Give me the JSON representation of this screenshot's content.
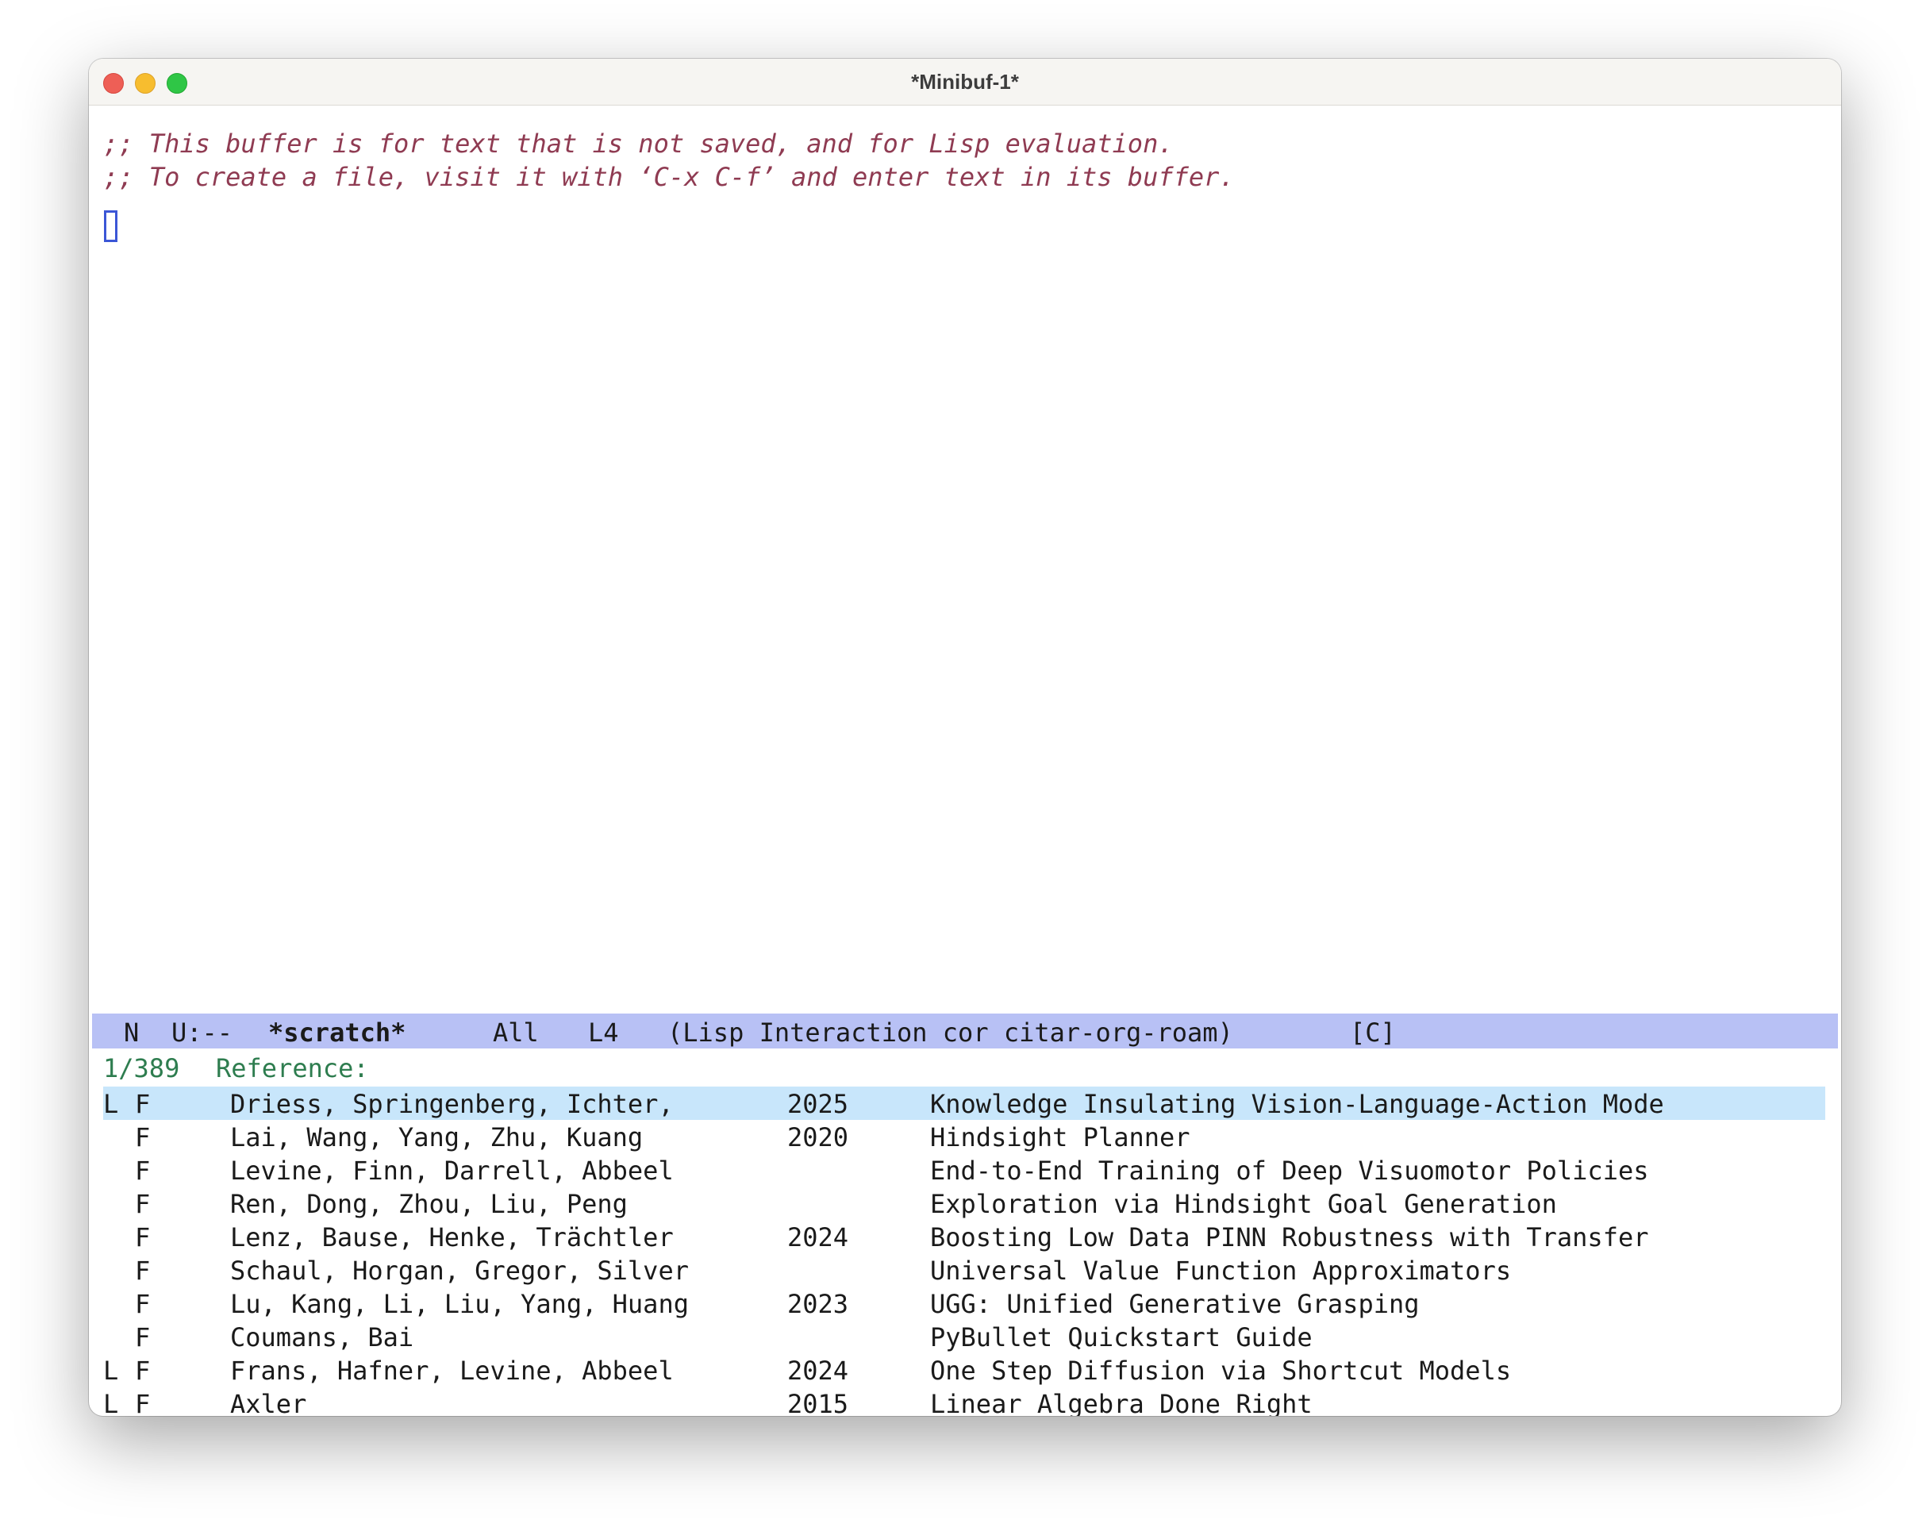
{
  "window": {
    "title": "*Minibuf-1*"
  },
  "editor": {
    "comment_line_1": ";; This buffer is for text that is not saved, and for Lisp evaluation.",
    "comment_line_2": ";; To create a file, visit it with ‘C-x C-f’ and enter text in its buffer."
  },
  "modeline": {
    "state": "N",
    "status": "U:--",
    "buffer_name": "*scratch*",
    "position": "All",
    "line": "L4",
    "modes": "(Lisp Interaction cor citar-org-roam)",
    "indicator": "[C]"
  },
  "minibuffer": {
    "count": "1/389",
    "prompt": "Reference:",
    "candidates": [
      {
        "flag_l": "L",
        "flag_f": "F",
        "authors": "Driess, Springenberg, Ichter,",
        "year": "2025",
        "title": "Knowledge Insulating Vision-Language-Action Mode",
        "selected": true
      },
      {
        "flag_l": "",
        "flag_f": "F",
        "authors": "Lai, Wang, Yang, Zhu, Kuang",
        "year": "2020",
        "title": "Hindsight Planner",
        "selected": false
      },
      {
        "flag_l": "",
        "flag_f": "F",
        "authors": "Levine, Finn, Darrell, Abbeel",
        "year": "",
        "title": "End-to-End Training of Deep Visuomotor Policies",
        "selected": false
      },
      {
        "flag_l": "",
        "flag_f": "F",
        "authors": "Ren, Dong, Zhou, Liu, Peng",
        "year": "",
        "title": "Exploration via Hindsight Goal Generation",
        "selected": false
      },
      {
        "flag_l": "",
        "flag_f": "F",
        "authors": "Lenz, Bause, Henke, Trächtler",
        "year": "2024",
        "title": "Boosting Low Data PINN Robustness with Transfer",
        "selected": false
      },
      {
        "flag_l": "",
        "flag_f": "F",
        "authors": "Schaul, Horgan, Gregor, Silver",
        "year": "",
        "title": "Universal Value Function Approximators",
        "selected": false
      },
      {
        "flag_l": "",
        "flag_f": "F",
        "authors": "Lu, Kang, Li, Liu, Yang, Huang",
        "year": "2023",
        "title": "UGG: Unified Generative Grasping",
        "selected": false
      },
      {
        "flag_l": "",
        "flag_f": "F",
        "authors": "Coumans, Bai",
        "year": "",
        "title": "PyBullet Quickstart Guide",
        "selected": false
      },
      {
        "flag_l": "L",
        "flag_f": "F",
        "authors": "Frans, Hafner, Levine, Abbeel",
        "year": "2024",
        "title": "One Step Diffusion via Shortcut Models",
        "selected": false
      },
      {
        "flag_l": "L",
        "flag_f": "F",
        "authors": "Axler",
        "year": "2015",
        "title": "Linear Algebra Done Right",
        "selected": false
      }
    ]
  }
}
